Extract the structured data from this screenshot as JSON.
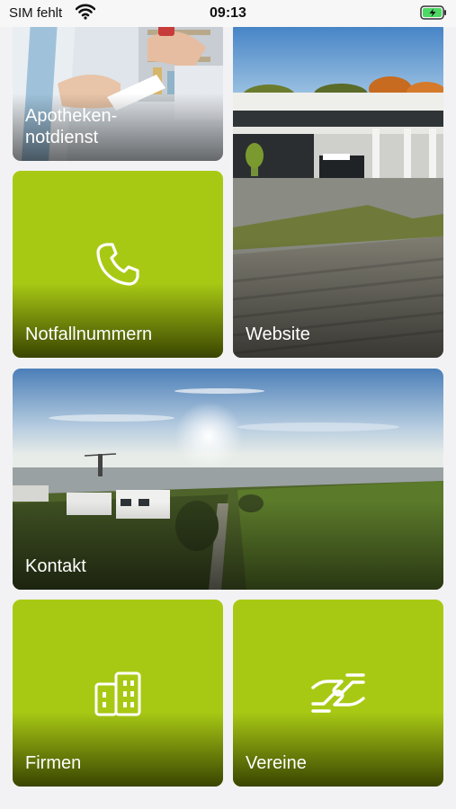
{
  "status_bar": {
    "carrier": "SIM fehlt",
    "time": "09:13",
    "icons": [
      "wifi-icon",
      "battery-charging-icon"
    ],
    "battery_color": "#4cd964"
  },
  "colors": {
    "tile_green": "#a8c914",
    "tile_green_dark": "#3c4a00",
    "label_text": "#ffffff",
    "background": "#f2f2f4"
  },
  "tiles": {
    "apotheken": {
      "label": "Apotheken-\nnotdienst",
      "type": "photo",
      "icon": null
    },
    "notfall": {
      "label": "Notfallnummern",
      "type": "green",
      "icon": "phone-icon"
    },
    "website": {
      "label": "Website",
      "type": "photo",
      "icon": null
    },
    "kontakt": {
      "label": "Kontakt",
      "type": "photo",
      "icon": null
    },
    "firmen": {
      "label": "Firmen",
      "type": "green",
      "icon": "buildings-icon"
    },
    "vereine": {
      "label": "Vereine",
      "type": "green",
      "icon": "handshake-icon"
    }
  }
}
